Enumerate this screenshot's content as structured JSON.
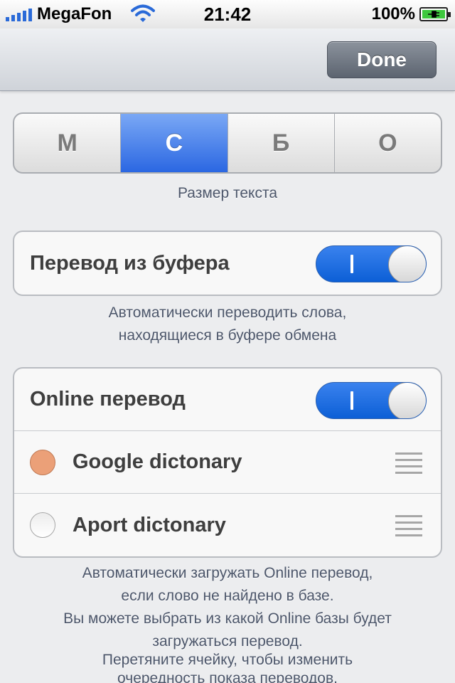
{
  "status_bar": {
    "carrier": "MegaFon",
    "time": "21:42",
    "battery_percent": "100%"
  },
  "navbar": {
    "done_label": "Done"
  },
  "text_size": {
    "segments": [
      "М",
      "С",
      "Б",
      "О"
    ],
    "selected_index": 1,
    "caption": "Размер текста"
  },
  "clipboard": {
    "label": "Перевод из буфера",
    "enabled": true,
    "description_line1": "Автоматически переводить слова,",
    "description_line2": "находящиеся в буфере обмена"
  },
  "online": {
    "label": "Online перевод",
    "enabled": true,
    "sources": [
      {
        "name": "Google dictonary",
        "selected": true
      },
      {
        "name": "Aport dictonary",
        "selected": false
      }
    ],
    "description_lines": [
      "Автоматически загружать Online перевод,",
      "если слово не найдено в базе.",
      "Вы можете выбрать из какой Online базы будет",
      "загружаться перевод.",
      "Перетяните ячейку, чтобы изменить",
      "очередность показа переводов."
    ]
  },
  "colors": {
    "accent_blue": "#2b67e2",
    "radio_selected": "#eba078"
  },
  "icons": [
    "signal-icon",
    "wifi-icon",
    "battery-icon",
    "reorder-handle-icon"
  ]
}
